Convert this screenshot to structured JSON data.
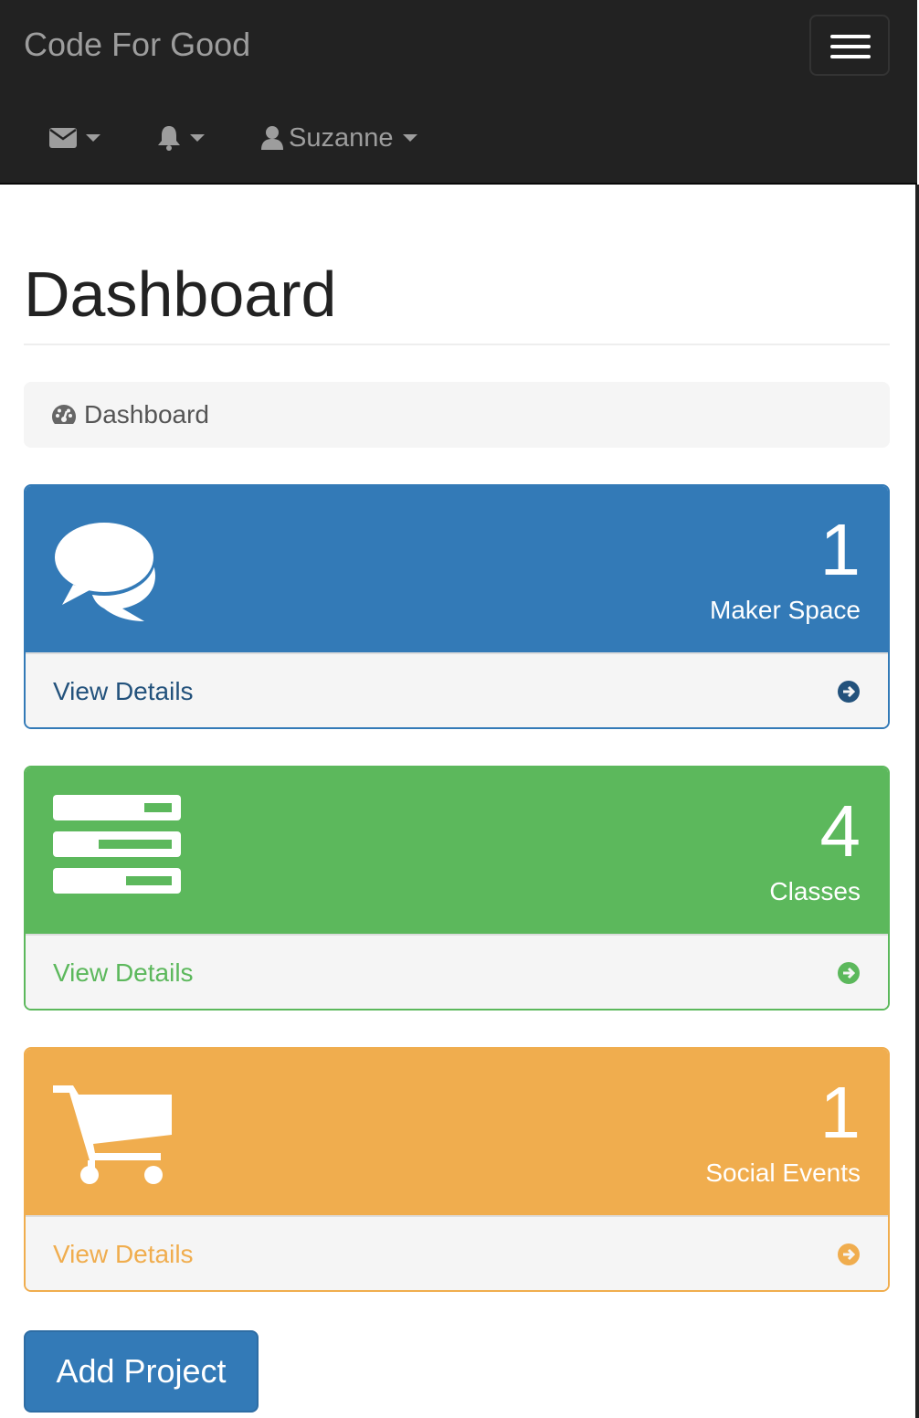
{
  "navbar": {
    "brand": "Code For Good",
    "user_label": "Suzanne"
  },
  "page": {
    "title": "Dashboard",
    "breadcrumb": "Dashboard"
  },
  "panels": [
    {
      "count": "1",
      "label": "Maker Space",
      "link": "View Details",
      "color": "#337ab7",
      "icon": "comments-icon"
    },
    {
      "count": "4",
      "label": "Classes",
      "link": "View Details",
      "color": "#5cb85c",
      "icon": "tasks-icon"
    },
    {
      "count": "1",
      "label": "Social Events",
      "link": "View Details",
      "color": "#f0ad4e",
      "icon": "shopping-cart-icon"
    }
  ],
  "actions": {
    "add_project": "Add Project"
  }
}
